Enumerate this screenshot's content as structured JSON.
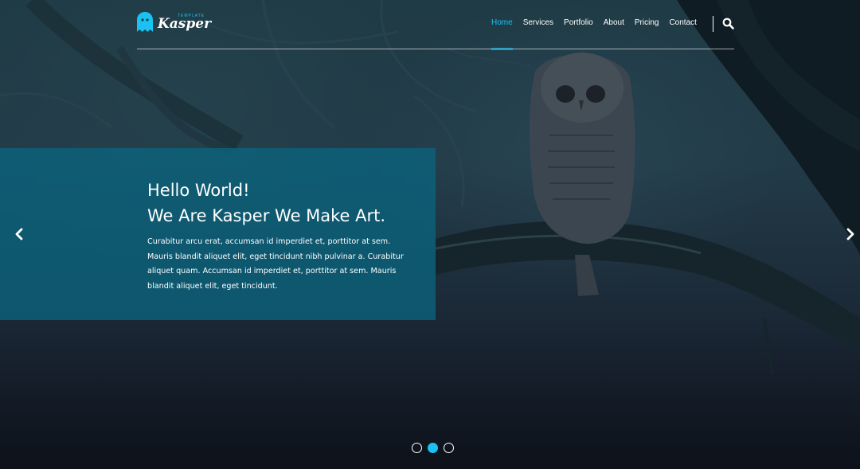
{
  "logo": {
    "tagline": "TEMPLATE",
    "name": "Kasper"
  },
  "nav": [
    {
      "label": "Home",
      "active": true
    },
    {
      "label": "Services",
      "active": false
    },
    {
      "label": "Portfolio",
      "active": false
    },
    {
      "label": "About",
      "active": false
    },
    {
      "label": "Pricing",
      "active": false
    },
    {
      "label": "Contact",
      "active": false
    }
  ],
  "slide": {
    "heading_line1": "Hello World!",
    "heading_line2": "We Are Kasper We Make Art.",
    "body": "Curabitur arcu erat, accumsan id imperdiet et, porttitor at sem. Mauris blandit aliquet elit, eget tincidunt nibh pulvinar a. Curabitur aliquet quam. Accumsan id imperdiet et, porttitor at sem. Mauris blandit aliquet elit, eget tincidunt."
  },
  "carousel": {
    "slide_count": 3,
    "active_index": 1
  },
  "colors": {
    "accent": "#19c2f3",
    "panel": "#0a647d"
  },
  "icons": {
    "search": "search-icon",
    "prev": "chevron-left-icon",
    "next": "chevron-right-icon",
    "logo": "ghost-icon"
  }
}
